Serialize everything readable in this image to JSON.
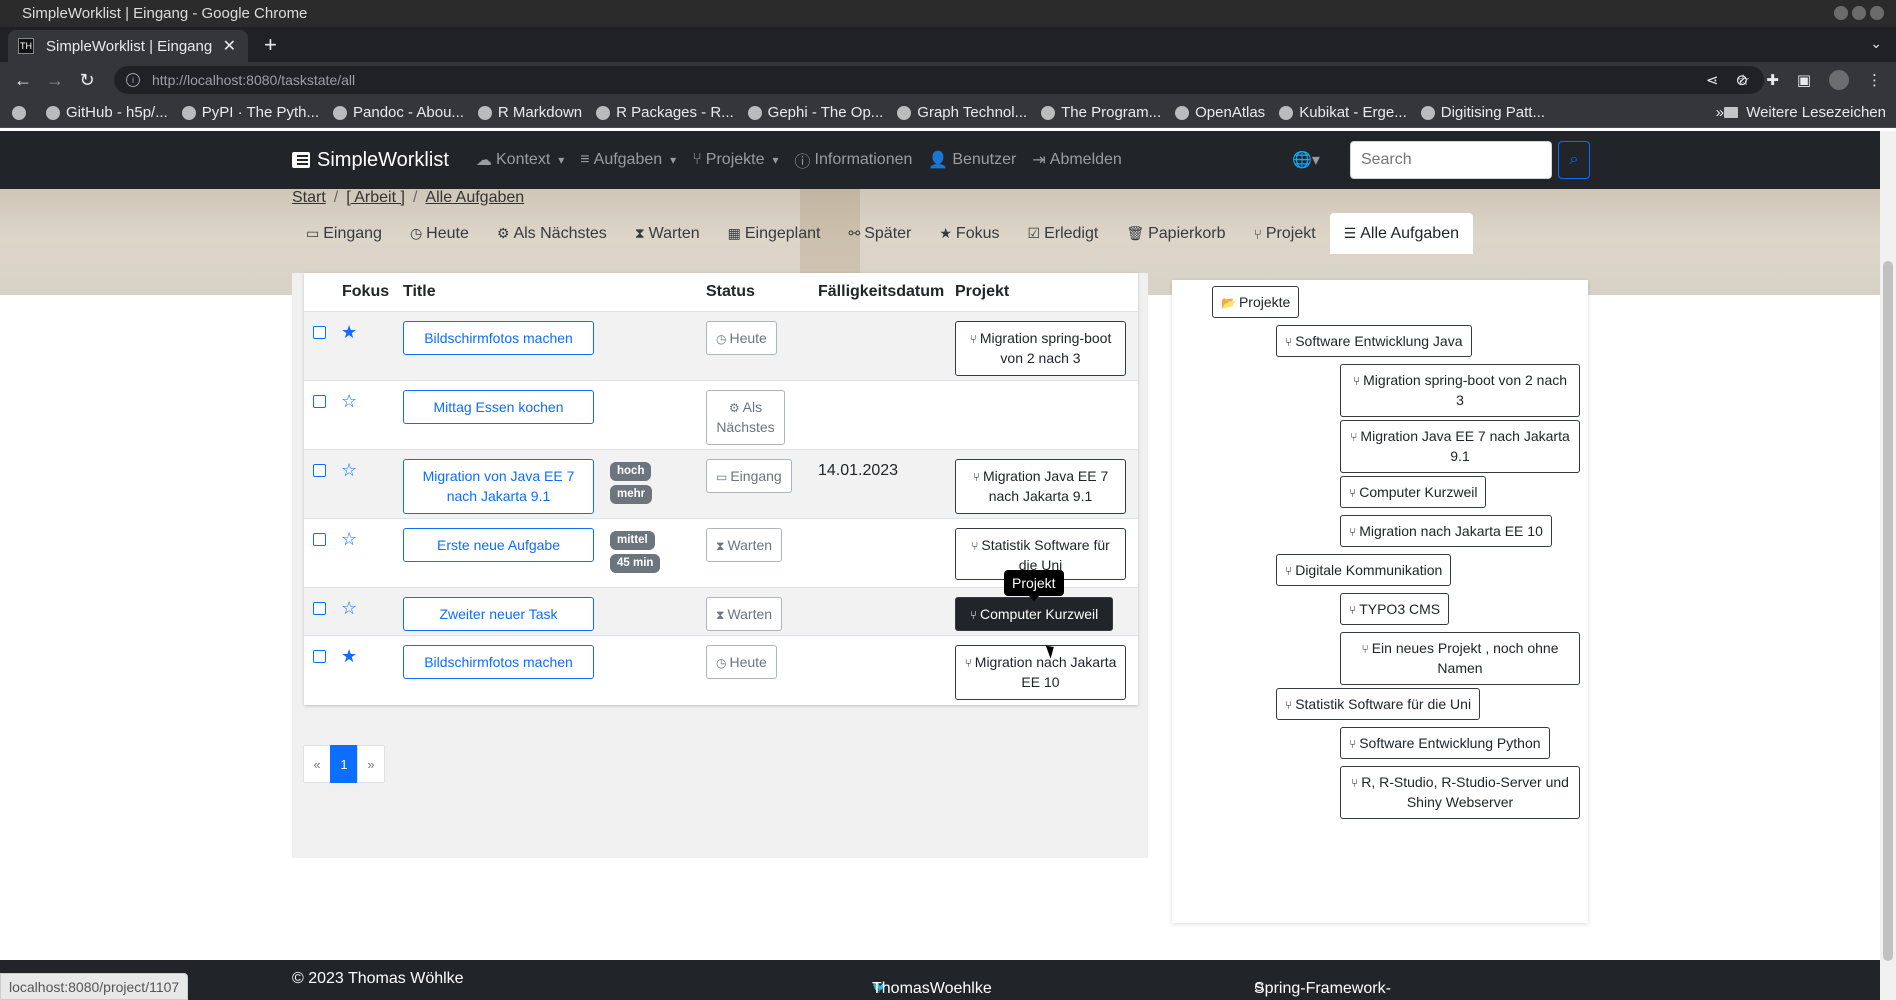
{
  "window": {
    "title": "SimpleWorklist | Eingang - Google Chrome"
  },
  "browser": {
    "tab_title": "SimpleWorklist | Eingang",
    "favicon_text": "TH",
    "url_host": "http://localhost",
    "url_rest": ":8080/taskstate/all",
    "bookmarks": [
      "GitHub - h5p/...",
      "PyPI · The Pyth...",
      "Pandoc - Abou...",
      "R Markdown",
      "R Packages - R...",
      "Gephi - The Op...",
      "Graph Technol...",
      "The Program...",
      "OpenAtlas",
      "Kubikat - Erge...",
      "Digitising Patt..."
    ],
    "bookmarks_more": "»",
    "bookmarks_folder": "Weitere Lesezeichen"
  },
  "navbar": {
    "brand": "SimpleWorklist",
    "menu": [
      "Kontext",
      "Aufgaben",
      "Projekte",
      "Informationen",
      "Benutzer",
      "Abmelden"
    ],
    "search_placeholder": "Search"
  },
  "breadcrumb": [
    "Start",
    "[ Arbeit ]",
    "Alle Aufgaben"
  ],
  "tabs": [
    "Eingang",
    "Heute",
    "Als Nächstes",
    "Warten",
    "Eingeplant",
    "Später",
    "Fokus",
    "Erledigt",
    "Papierkorb",
    "Projekt",
    "Alle Aufgaben"
  ],
  "table": {
    "headers": [
      "Fokus",
      "Title",
      "Status",
      "Fälligkeitsdatum",
      "Projekt"
    ],
    "rows": [
      {
        "focus": true,
        "title": "Bildschirmfotos machen",
        "badges": [],
        "status": "Heute",
        "due": "",
        "project": "Migration spring-boot von 2 nach 3"
      },
      {
        "focus": false,
        "title": "Mittag Essen kochen",
        "badges": [],
        "status": "Als Nächstes",
        "due": "",
        "project": ""
      },
      {
        "focus": false,
        "title": "Migration von Java EE 7 nach Jakarta 9.1",
        "badges": [
          "hoch",
          "mehr"
        ],
        "status": "Eingang",
        "due": "14.01.2023",
        "project": "Migration Java EE 7 nach Jakarta 9.1"
      },
      {
        "focus": false,
        "title": "Erste neue Aufgabe",
        "badges": [
          "mittel",
          "45 min"
        ],
        "status": "Warten",
        "due": "",
        "project": "Statistik Software für die Uni"
      },
      {
        "focus": false,
        "title": "Zweiter neuer Task",
        "badges": [],
        "status": "Warten",
        "due": "",
        "project": "Computer Kurzweil"
      },
      {
        "focus": true,
        "title": "Bildschirmfotos machen",
        "badges": [],
        "status": "Heute",
        "due": "",
        "project": "Migration nach Jakarta EE 10"
      }
    ]
  },
  "tooltip": "Projekt",
  "pagination": {
    "prev": "«",
    "current": "1",
    "next": "»"
  },
  "tree": {
    "root": "Projekte",
    "nodes": [
      "Software Entwicklung Java",
      "Migration spring-boot von 2 nach 3",
      "Migration Java EE 7 nach Jakarta 9.1",
      "Computer Kurzweil",
      "Migration nach Jakarta EE 10",
      "Digitale Kommunikation",
      "TYPO3 CMS",
      "Ein neues Projekt , noch ohne Namen",
      "Statistik Software für die Uni",
      "Software Entwicklung Python",
      "R, R-Studio, R-Studio-Server und Shiny Webserver"
    ]
  },
  "footer": {
    "copyright": "© 2023 Thomas Wöhlke",
    "twitter": "ThomasWoehlke",
    "github": "Spring-Framework-Java-Apps/simpleworklist"
  },
  "statusbar": "localhost:8080/project/1107"
}
